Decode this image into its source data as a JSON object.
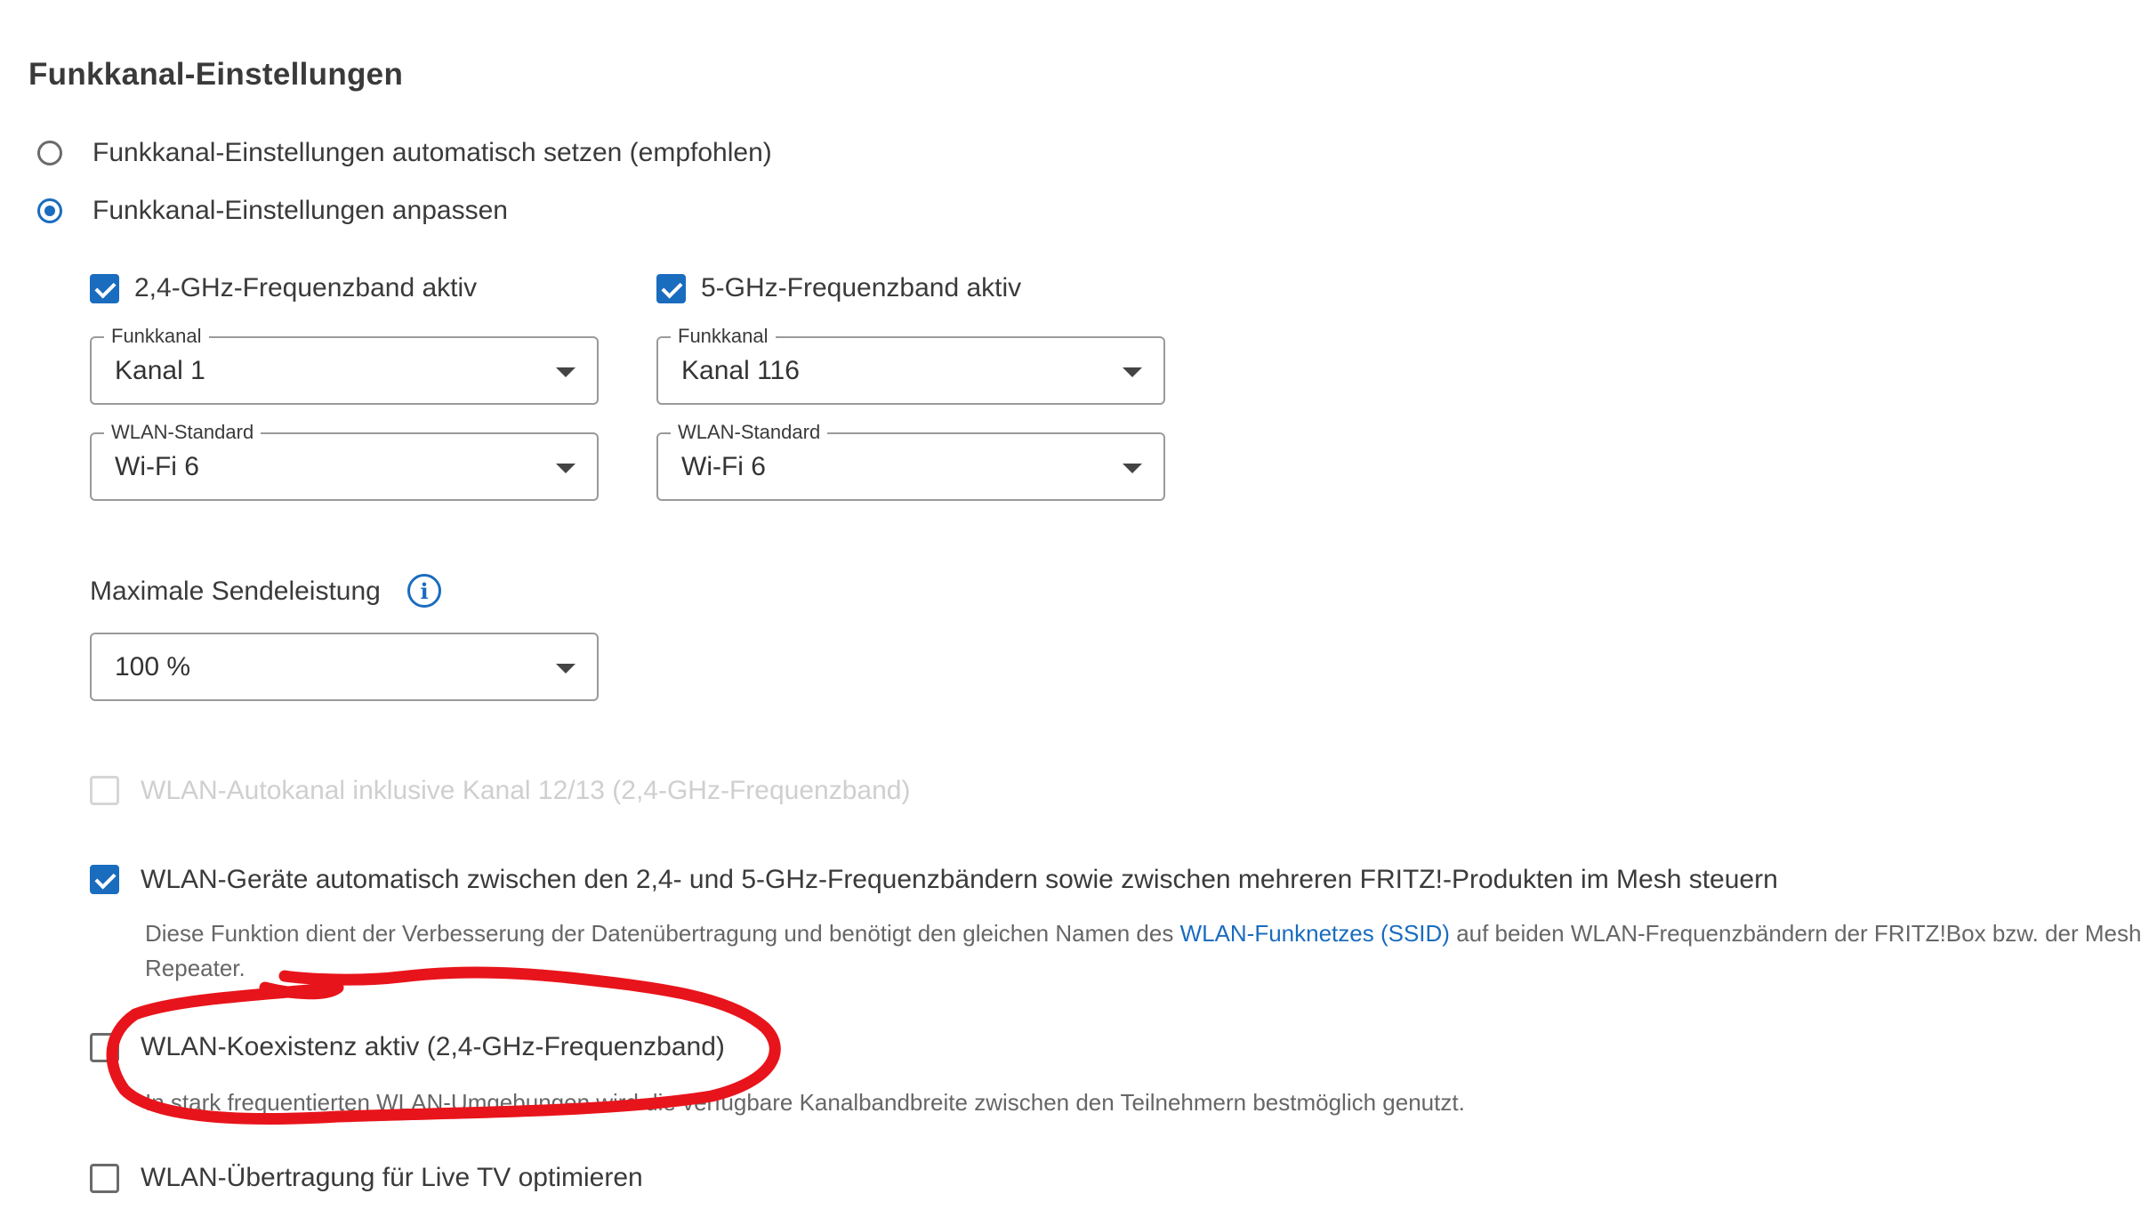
{
  "section": {
    "title": "Funkkanal-Einstellungen"
  },
  "mode": {
    "auto_label": "Funkkanal-Einstellungen automatisch setzen (empfohlen)",
    "custom_label": "Funkkanal-Einstellungen anpassen",
    "selected": "custom"
  },
  "band24": {
    "label": "2,4-GHz-Frequenzband aktiv",
    "checked": true,
    "channel": {
      "legend": "Funkkanal",
      "value": "Kanal 1"
    },
    "standard": {
      "legend": "WLAN-Standard",
      "value": "Wi-Fi 6"
    }
  },
  "band5": {
    "label": "5-GHz-Frequenzband aktiv",
    "checked": true,
    "channel": {
      "legend": "Funkkanal",
      "value": "Kanal 116"
    },
    "standard": {
      "legend": "WLAN-Standard",
      "value": "Wi-Fi 6"
    }
  },
  "power": {
    "label": "Maximale Sendeleistung",
    "value": "100 %",
    "info_icon": "info-icon"
  },
  "options": {
    "autochannel": {
      "label": "WLAN-Autokanal inklusive Kanal 12/13 (2,4-GHz-Frequenzband)",
      "checked": false,
      "disabled": true
    },
    "steering": {
      "label": "WLAN-Geräte automatisch zwischen den 2,4- und 5-GHz-Frequenzbändern sowie zwischen mehreren FRITZ!-Produkten im Mesh steuern",
      "checked": true,
      "desc_before": "Diese Funktion dient der Verbesserung der Datenübertragung und benötigt den gleichen Namen des ",
      "desc_link": "WLAN-Funknetzes (SSID)",
      "desc_after": " auf beiden WLAN-Frequenzbändern der FRITZ!Box bzw. der Mesh-",
      "desc_line2": "Repeater."
    },
    "coexistence": {
      "label": "WLAN-Koexistenz aktiv (2,4-GHz-Frequenzband)",
      "checked": false,
      "desc": "In stark frequentierten WLAN-Umgebungen wird die verfügbare Kanalbandbreite zwischen den Teilnehmern bestmöglich genutzt."
    },
    "livetv": {
      "label": "WLAN-Übertragung für Live TV optimieren",
      "checked": false
    }
  },
  "colors": {
    "accent": "#1a6cbf",
    "annotation": "#e8141b"
  }
}
